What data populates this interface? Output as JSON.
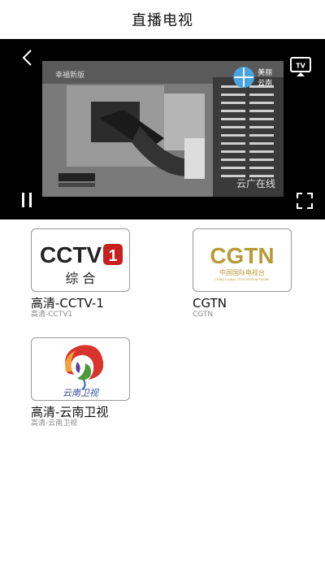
{
  "header": {
    "title": "直播电视"
  },
  "player": {
    "overlay_left": "幸福新版",
    "overlay_right": "美丽云南",
    "overlay_bottom": "云广在线",
    "icons": [
      "back-icon",
      "tv-cast-icon",
      "pause-icon",
      "fullscreen-icon"
    ],
    "state": "playing"
  },
  "channels": [
    {
      "name": "高清-CCTV-1",
      "subtitle": "高清-CCTV1",
      "logo_text": "CCTV",
      "logo_number": "1",
      "logo_caption": "综 合",
      "logo_color": "#c81e1e"
    },
    {
      "name": "CGTN",
      "subtitle": "CGTN",
      "logo_text": "CGTN",
      "logo_caption": "中国国际电视台",
      "logo_tagline": "CHINA GLOBAL TELEVISION NETWORK",
      "logo_color": "#b89a3a"
    },
    {
      "name": "高清-云南卫视",
      "subtitle": "高清-云南卫视",
      "logo_caption": "云南卫视",
      "logo_color": "#3a4aa0"
    }
  ]
}
